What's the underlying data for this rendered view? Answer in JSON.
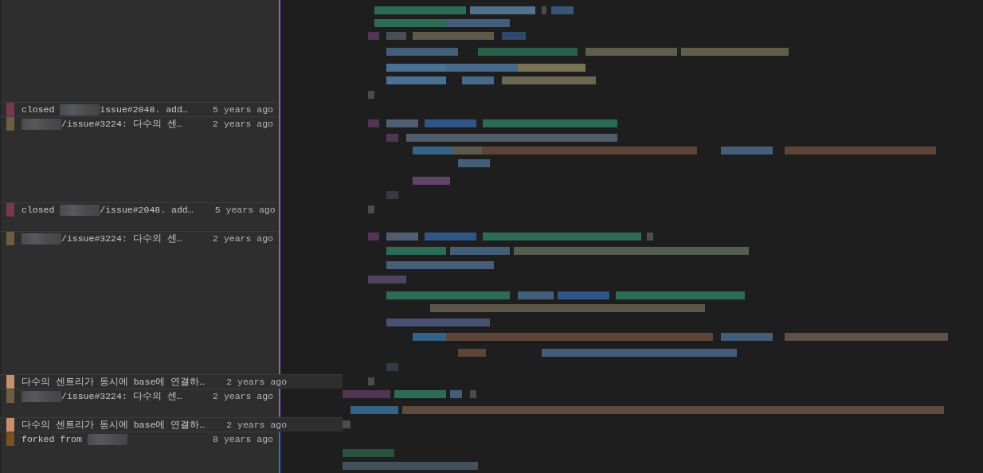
{
  "blame": [
    {
      "color": "#7a3553",
      "message": [
        {
          "kind": "text",
          "text": "closed "
        },
        {
          "kind": "redacted"
        },
        {
          "kind": "text",
          "text": "issue#2048. add…"
        }
      ],
      "time": "5 years ago",
      "wide": false
    },
    {
      "color": "#6b5f3f",
      "message": [
        {
          "kind": "redacted"
        },
        {
          "kind": "text",
          "text": "/issue#3224: 다수의 센…"
        }
      ],
      "time": "2 years ago",
      "wide": false
    },
    {
      "color": "#7a3553",
      "message": [
        {
          "kind": "text",
          "text": "closed "
        },
        {
          "kind": "redacted"
        },
        {
          "kind": "text",
          "text": "/issue#2048. add…"
        }
      ],
      "time": "5 years ago",
      "wide": false
    },
    {
      "color": "#6b5f3f",
      "message": [
        {
          "kind": "redacted"
        },
        {
          "kind": "text",
          "text": "/issue#3224: 다수의 센…"
        }
      ],
      "time": "2 years ago",
      "wide": false
    },
    {
      "color": "#c8906a",
      "message": [
        {
          "kind": "text",
          "text": "다수의 센트리가 동시에 base에 연결하…"
        }
      ],
      "time": "2 years ago",
      "wide": true
    },
    {
      "color": "#6b5f3f",
      "message": [
        {
          "kind": "redacted"
        },
        {
          "kind": "text",
          "text": "/issue#3224: 다수의 센…"
        }
      ],
      "time": "2 years ago",
      "wide": false
    },
    {
      "color": "#c8906a",
      "message": [
        {
          "kind": "text",
          "text": "다수의 센트리가 동시에 base에 연결하…"
        }
      ],
      "time": "2 years ago",
      "wide": true
    },
    {
      "color": "#7a5020",
      "message": [
        {
          "kind": "text",
          "text": "forked from "
        },
        {
          "kind": "redacted"
        }
      ],
      "time": "8 years ago",
      "wide": false
    }
  ]
}
